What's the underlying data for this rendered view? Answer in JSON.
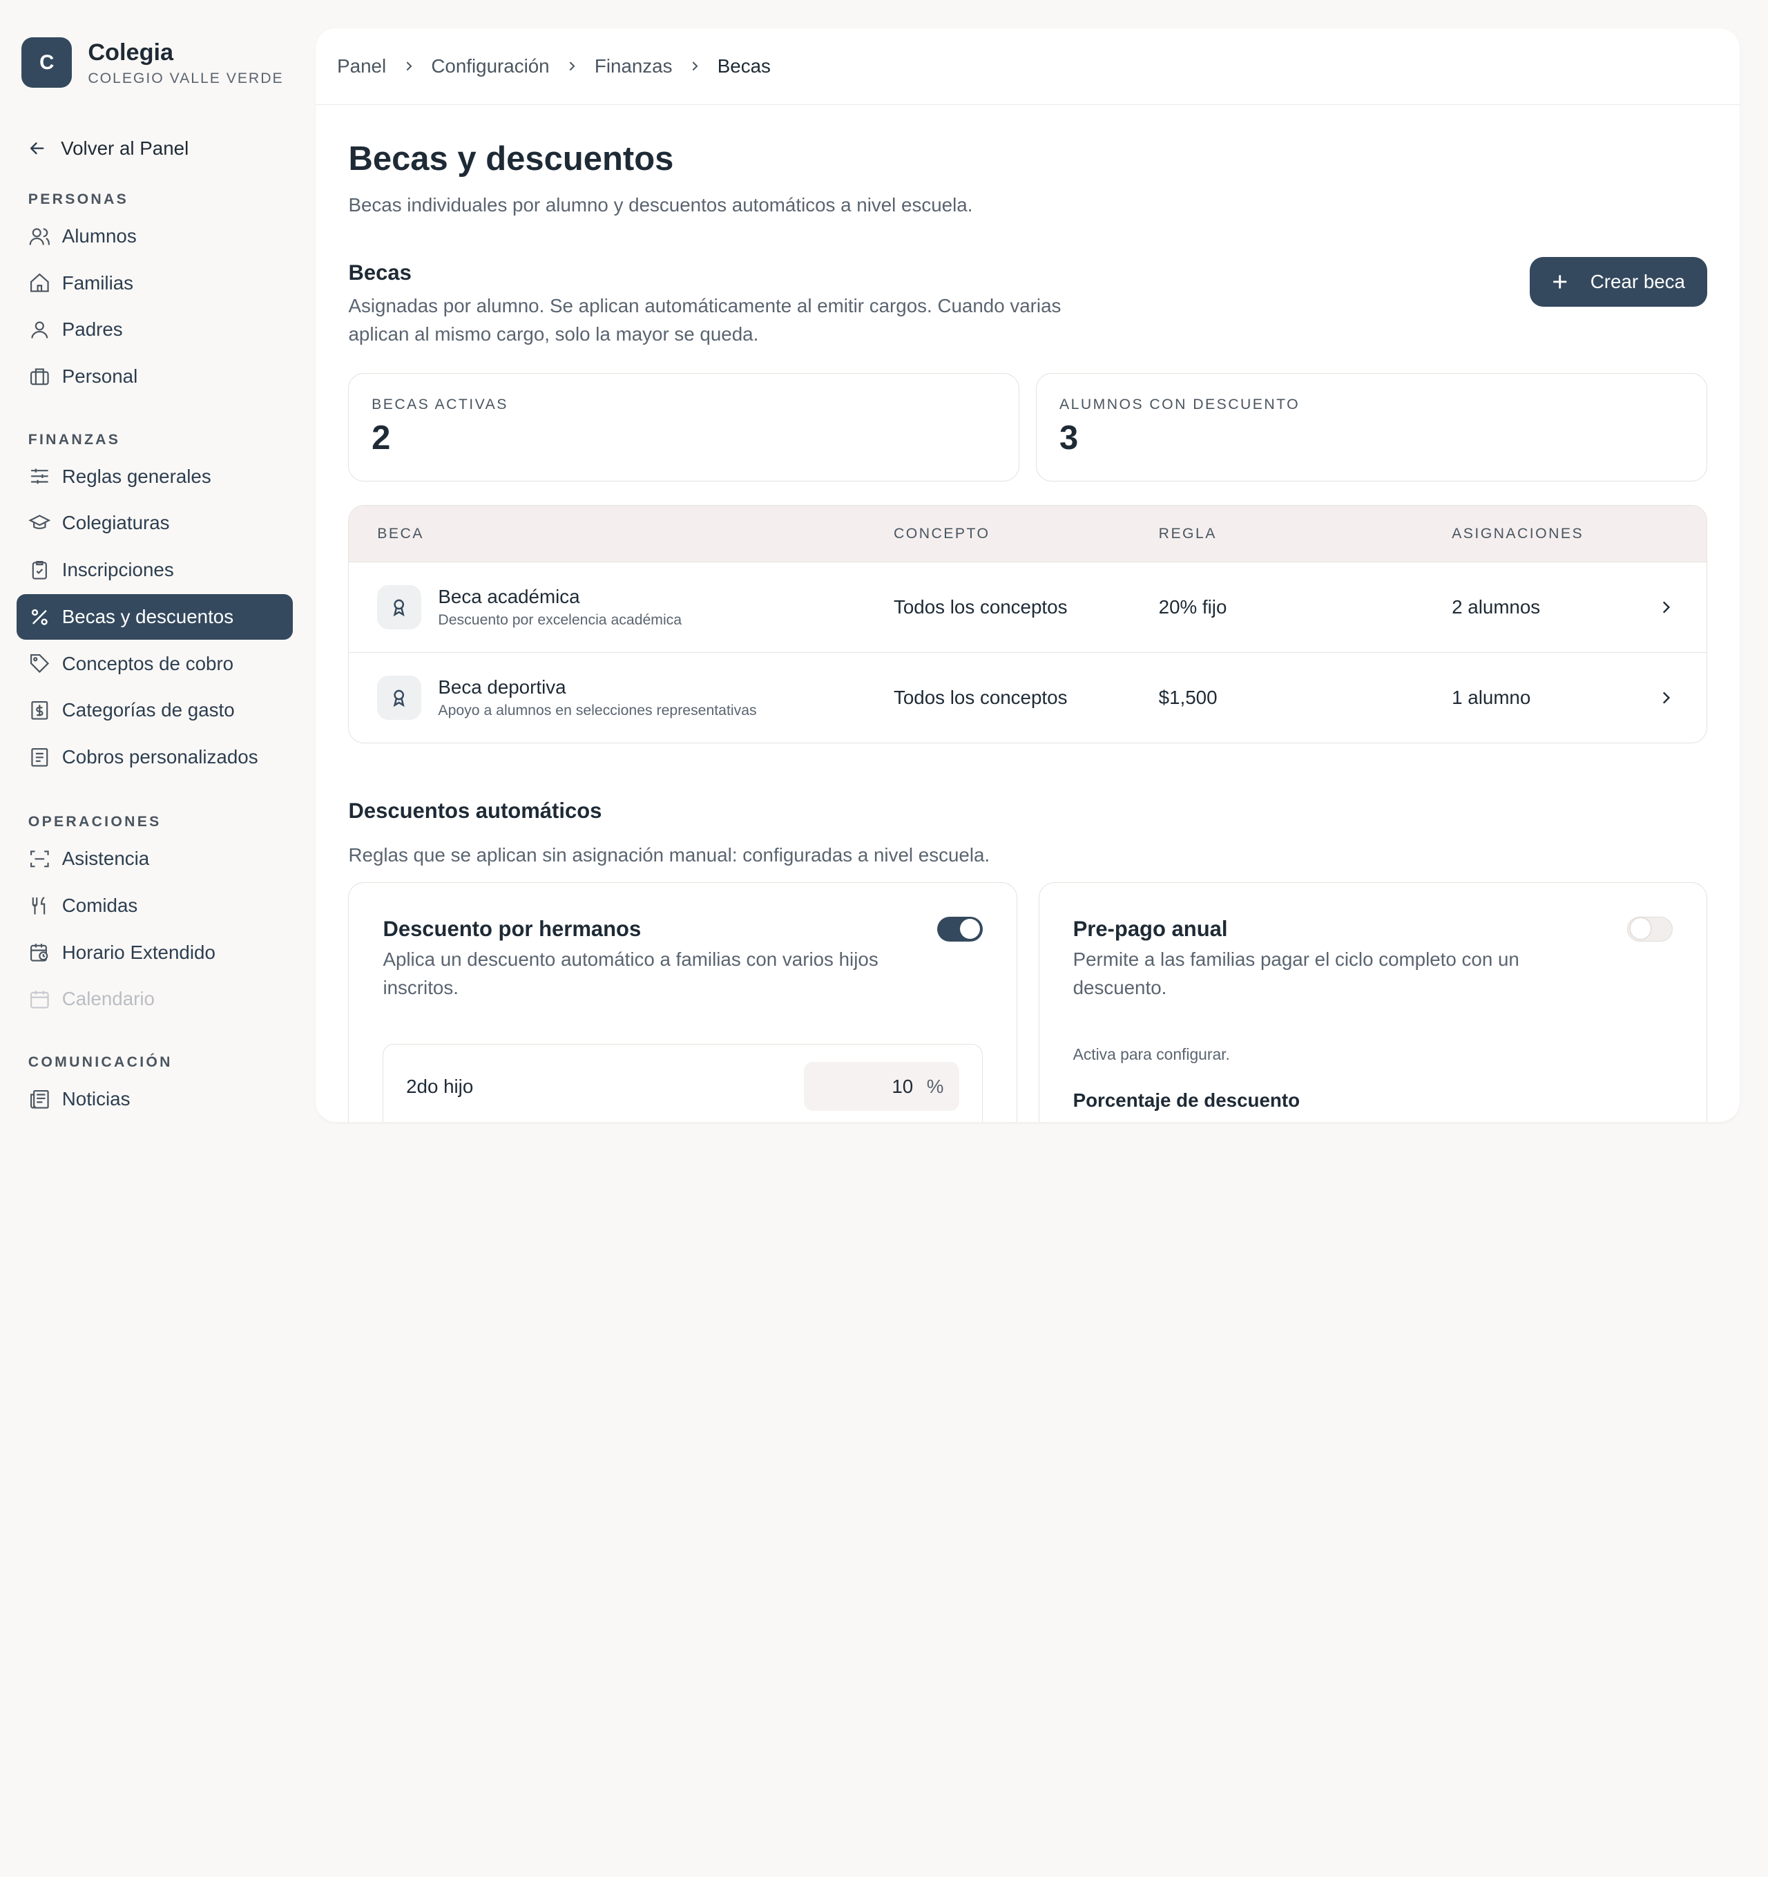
{
  "brand": {
    "initial": "C",
    "name": "Colegia",
    "school": "COLEGIO VALLE VERDE"
  },
  "sidebar": {
    "back_label": "Volver al Panel",
    "sections": [
      {
        "heading": "PERSONAS",
        "items": [
          "Alumnos",
          "Familias",
          "Padres",
          "Personal"
        ]
      },
      {
        "heading": "FINANZAS",
        "items": [
          "Reglas generales",
          "Colegiaturas",
          "Inscripciones",
          "Becas y descuentos",
          "Conceptos de cobro",
          "Categorías de gasto",
          "Cobros personalizados"
        ]
      },
      {
        "heading": "OPERACIONES",
        "items": [
          "Asistencia",
          "Comidas",
          "Horario Extendido",
          "Calendario"
        ]
      },
      {
        "heading": "COMUNICACIÓN",
        "items": [
          "Noticias"
        ]
      }
    ],
    "active_item": "Becas y descuentos",
    "disabled_item": "Calendario"
  },
  "breadcrumb": [
    "Panel",
    "Configuración",
    "Finanzas",
    "Becas"
  ],
  "page": {
    "title": "Becas y descuentos",
    "subtitle": "Becas individuales por alumno y descuentos automáticos a nivel escuela."
  },
  "becas": {
    "title": "Becas",
    "description": "Asignadas por alumno. Se aplican automáticamente al emitir cargos. Cuando varias aplican al mismo cargo, solo la mayor se queda.",
    "create_label": "Crear beca",
    "stats": [
      {
        "label": "BECAS ACTIVAS",
        "value": "2"
      },
      {
        "label": "ALUMNOS CON DESCUENTO",
        "value": "3"
      }
    ],
    "columns": [
      "BECA",
      "CONCEPTO",
      "REGLA",
      "ASIGNACIONES"
    ],
    "rows": [
      {
        "name": "Beca académica",
        "desc": "Descuento por excelencia académica",
        "concepto": "Todos los conceptos",
        "regla": "20% fijo",
        "asignaciones": "2 alumnos"
      },
      {
        "name": "Beca deportiva",
        "desc": "Apoyo a alumnos en selecciones representativas",
        "concepto": "Todos los conceptos",
        "regla": "$1,500",
        "asignaciones": "1 alumno"
      }
    ]
  },
  "auto": {
    "title": "Descuentos automáticos",
    "description": "Reglas que se aplican sin asignación manual: configuradas a nivel escuela.",
    "cards": [
      {
        "title": "Descuento por hermanos",
        "desc": "Aplica un descuento automático a familias con varios hijos inscritos.",
        "enabled": true,
        "row_label": "2do hijo",
        "row_value": "10",
        "row_unit": "%"
      },
      {
        "title": "Pre-pago anual",
        "desc": "Permite a las familias pagar el ciclo completo con un descuento.",
        "enabled": false,
        "note": "Activa para configurar.",
        "field_label": "Porcentaje de descuento"
      }
    ]
  },
  "colors": {
    "accent": "#34495e",
    "background": "#faf8f6",
    "table_header": "#f4efee"
  }
}
